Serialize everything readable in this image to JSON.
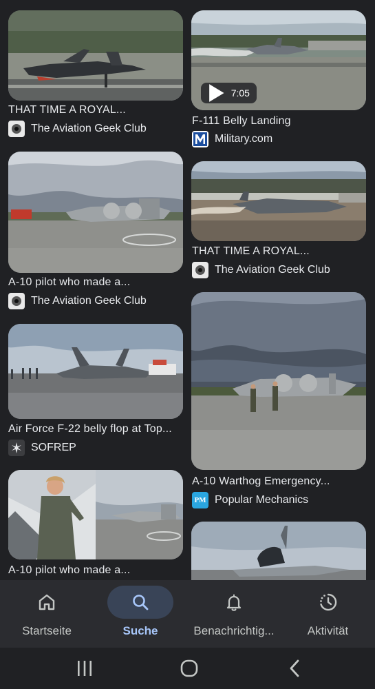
{
  "results": [
    {
      "title": "THAT TIME A ROYAL...",
      "source": "The Aviation Geek Club",
      "favicon": "aviation-geek-club-icon"
    },
    {
      "title": "F-111 Belly Landing",
      "source": "Military.com",
      "favicon": "military-com-icon",
      "duration": "7:05"
    },
    {
      "title": "A-10 pilot who made a...",
      "source": "The Aviation Geek Club",
      "favicon": "aviation-geek-club-icon"
    },
    {
      "title": "THAT TIME A ROYAL...",
      "source": "The Aviation Geek Club",
      "favicon": "aviation-geek-club-icon"
    },
    {
      "title": "Air Force F-22 belly flop at Top...",
      "source": "SOFREP",
      "favicon": "sofrep-icon"
    },
    {
      "title": "A-10 Warthog Emergency...",
      "source": "Popular Mechanics",
      "favicon": "popular-mechanics-icon",
      "favicon_text": "PM"
    },
    {
      "title": "A-10 pilot who made a...",
      "source": "",
      "favicon": ""
    }
  ],
  "nav": {
    "items": [
      {
        "label": "Startseite",
        "icon": "home-icon",
        "active": false
      },
      {
        "label": "Suche",
        "icon": "search-icon",
        "active": true
      },
      {
        "label": "Benachrichtig...",
        "icon": "bell-icon",
        "active": false
      },
      {
        "label": "Aktivität",
        "icon": "activity-icon",
        "active": false
      }
    ]
  },
  "colors": {
    "background": "#202124",
    "navbar": "#2b2c30",
    "active_pill": "#394457",
    "active_label": "#a8c7fa",
    "text": "#e8eaed"
  },
  "system_nav": [
    "recent-apps-icon",
    "home-button-icon",
    "back-icon"
  ]
}
